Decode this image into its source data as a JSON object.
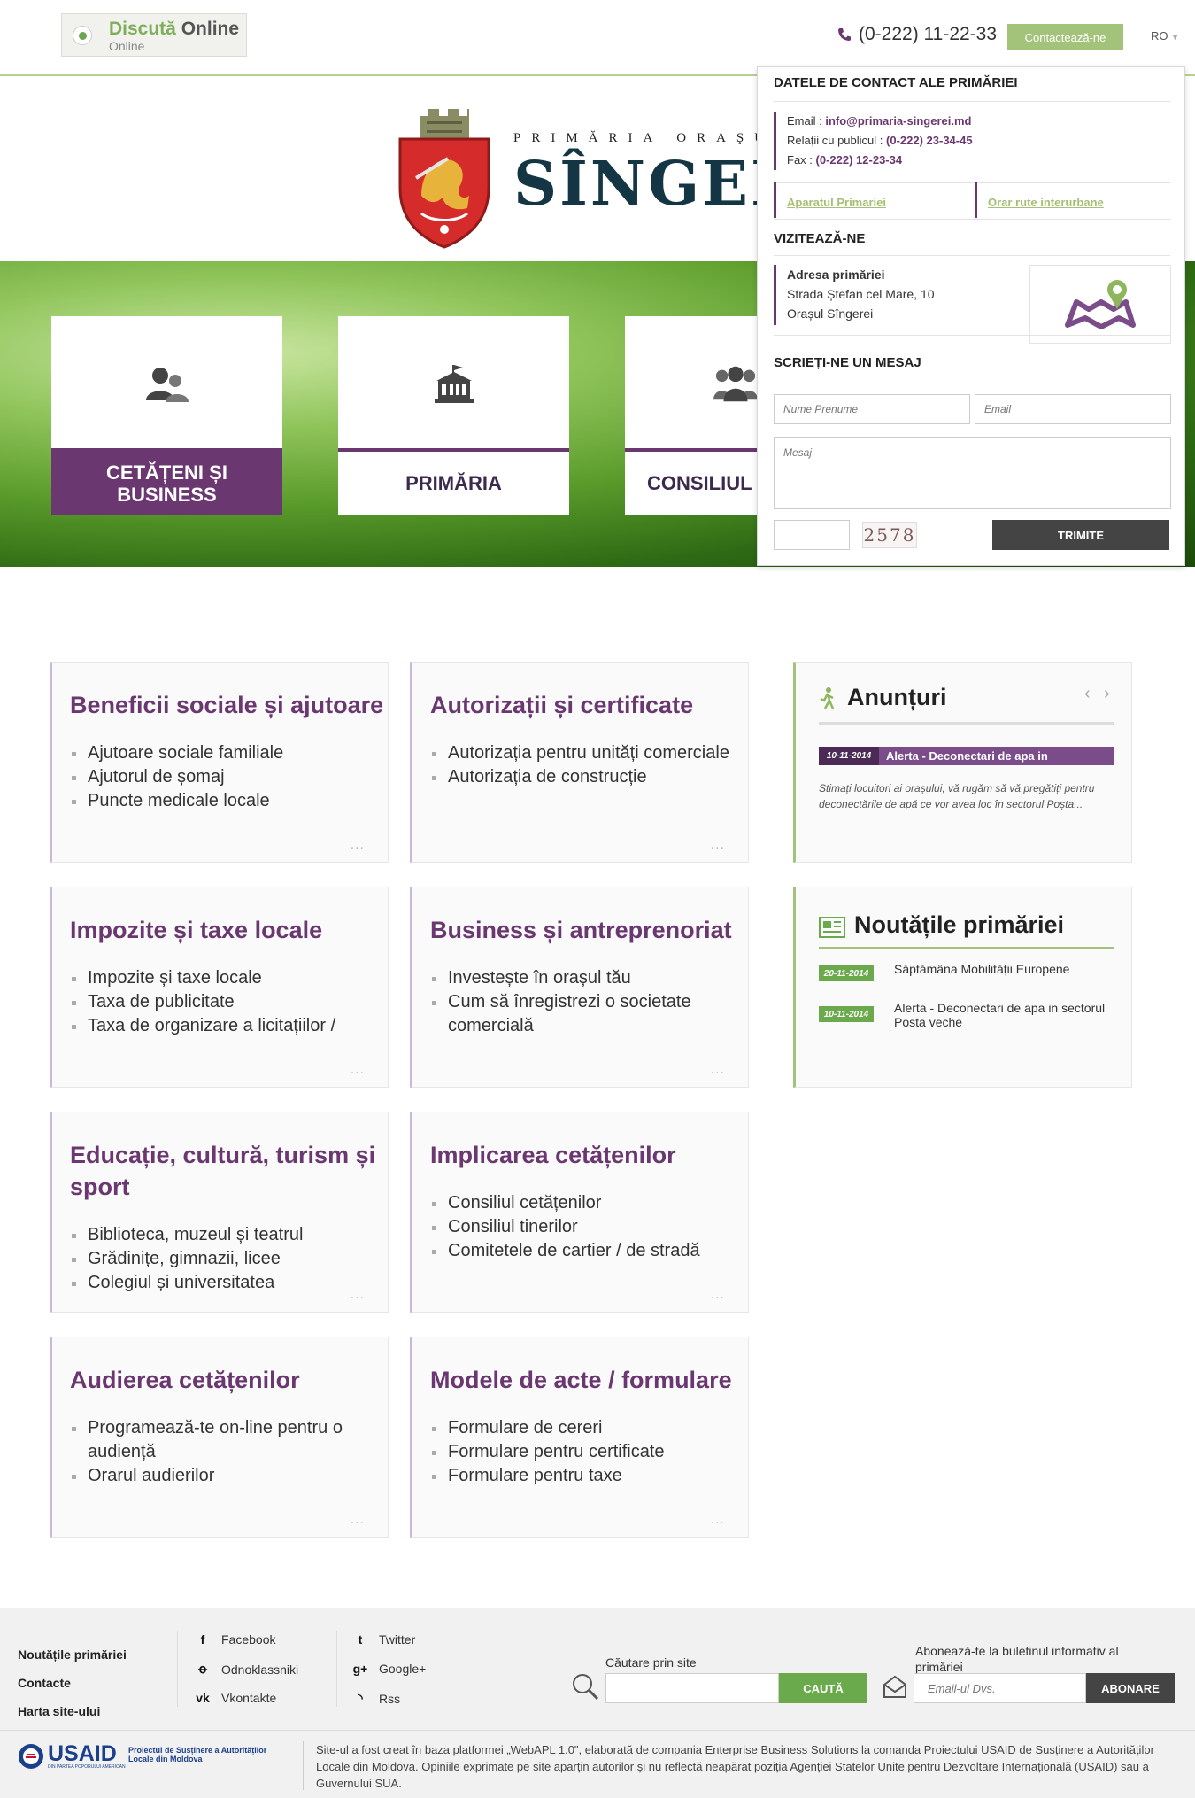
{
  "topbar": {
    "chat_title_1": "Discută",
    "chat_title_2": "Online",
    "chat_status": "Online",
    "phone": "(0-222) 11-22-33",
    "contact_label": "Contactează-ne",
    "lang": "RO"
  },
  "logo": {
    "small": "PRIMĂRIA ORAŞULUI",
    "big": "SÎNGEREI"
  },
  "tiles": [
    {
      "label": "CETĂȚENI ȘI BUSINESS"
    },
    {
      "label": "PRIMĂRIA"
    },
    {
      "label": "CONSILIUL"
    }
  ],
  "contact_panel": {
    "heading": "DATELE DE CONTACT ALE PRIMĂRIEI",
    "email_label": "Email :",
    "email": "info@primaria-singerei.md",
    "public_label": "Relații cu publicul :",
    "public": "(0-222) 23-34-45",
    "fax_label": "Fax :",
    "fax": "(0-222) 12-23-34",
    "link1": "Aparatul Primariei",
    "link2": "Orar rute interurbane",
    "visit_heading": "VIZITEAZĂ-NE",
    "addr_title": "Adresa primăriei",
    "addr_line1": "Strada Ștefan cel Mare, 10",
    "addr_line2": "Orașul Sîngerei",
    "write_heading": "SCRIEȚI-NE UN MESAJ",
    "name_placeholder": "Nume Prenume",
    "email_placeholder": "Email",
    "message_placeholder": "Mesaj",
    "captcha": "2578",
    "send_label": "TRIMITE"
  },
  "cards": [
    {
      "title": "Beneficii sociale și ajutoare",
      "items": [
        "Ajutoare sociale familiale",
        "Ajutorul de șomaj",
        "Puncte medicale locale"
      ]
    },
    {
      "title": "Autorizații și certificate",
      "items": [
        "Autorizația pentru unități comerciale",
        "Autorizația de construcție"
      ]
    },
    {
      "title": "Impozite și taxe locale",
      "items": [
        "Impozite și taxe locale",
        "Taxa de publicitate",
        "Taxa de organizare a licitațiilor /"
      ]
    },
    {
      "title": "Business și antreprenoriat",
      "items": [
        "Investește în orașul tău",
        "Cum să înregistrezi o societate comercială"
      ]
    },
    {
      "title": "Educație, cultură, turism și sport",
      "items": [
        "Biblioteca, muzeul și teatrul",
        "Grădinițe, gimnazii, licee",
        "Colegiul și universitatea"
      ]
    },
    {
      "title": "Implicarea cetățenilor",
      "items": [
        "Consiliul cetățenilor",
        "Consiliul tinerilor",
        "Comitetele de cartier / de stradă"
      ]
    },
    {
      "title": "Audierea cetățenilor",
      "items": [
        "Programează-te on-line pentru o audiență",
        "Orarul audierilor"
      ]
    },
    {
      "title": "Modele de acte / formulare",
      "items": [
        "Formulare de cereri",
        "Formulare pentru certificate",
        "Formulare pentru taxe"
      ]
    }
  ],
  "more": "...",
  "announcements": {
    "title": "Anunțuri",
    "date": "10-11-2014",
    "headline": "Alerta - Deconectari de apa in",
    "text": "Stimați locuitori ai orașului, vă rugăm să vă pregătiți pentru deconectările de apă ce vor avea loc în sectorul Poșta..."
  },
  "news": {
    "title": "Noutățile primăriei",
    "items": [
      {
        "date": "20-11-2014",
        "text": "Săptămâna Mobilității Europene"
      },
      {
        "date": "10-11-2014",
        "text": "Alerta - Deconectari de apa in sectorul Posta veche"
      }
    ]
  },
  "footer": {
    "links": [
      "Noutățile primăriei",
      "Contacte",
      "Harta site-ului"
    ],
    "social1": [
      "Facebook",
      "Odnoklassniki",
      "Vkontakte"
    ],
    "social2": [
      "Twitter",
      "Google+",
      "Rss"
    ],
    "search_label": "Căutare prin site",
    "search_btn": "CAUTĂ",
    "newsletter_label": "Abonează-te la buletinul informativ al primăriei",
    "newsletter_placeholder": "Email-ul Dvs.",
    "newsletter_btn": "ABONARE",
    "usaid": "USAID",
    "usaid_sub": "DIN PARTEA POPORULUI AMERICAN",
    "project": "Proiectul de Susținere a Autorităților Locale din Moldova",
    "credits": "Site-ul a fost creat în baza platformei „WebAPL 1.0\", elaborată de compania Enterprise Business Solutions la comanda Proiectului USAID de Susținere a Autorităților Locale din Moldova. Opiniile exprimate pe site aparțin autorilor și nu reflectă neapărat poziția Agenției Statelor Unite pentru Dezvoltare Internațională (USAID) sau a Guvernului SUA."
  },
  "colors": {
    "brand": "#6a3770",
    "accent": "#a3c27a",
    "green": "#6aaa4c"
  },
  "icons": [
    "phone-icon",
    "users-icon",
    "city-hall-icon",
    "council-icon",
    "map-pin-icon",
    "walker-icon",
    "newspaper-icon",
    "search-icon",
    "mail-icon",
    "facebook-icon",
    "odnoklassniki-icon",
    "vk-icon",
    "twitter-icon",
    "google-plus-icon",
    "rss-icon"
  ]
}
